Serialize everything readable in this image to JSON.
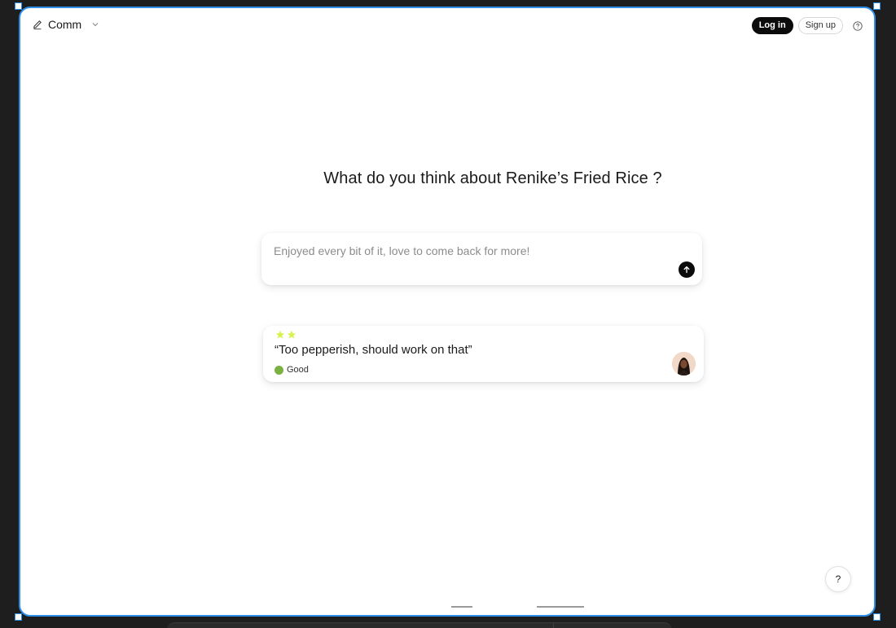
{
  "header": {
    "brand_name": "Comm",
    "brand_icon": "pen-icon",
    "login_label": "Log in",
    "signup_label": "Sign up",
    "help_icon": "help-circle-icon"
  },
  "main": {
    "question": "What do you think about Renike’s Fried Rice ?",
    "feedback_input": {
      "value": "",
      "placeholder": "Enjoyed every bit of it, love to come back for more!"
    },
    "send_icon": "arrow-up-icon"
  },
  "review": {
    "rating": 2,
    "star_color": "#d9f24a",
    "quote": "“Too pepperish, should work on that”",
    "badge_label": "Good",
    "badge_color": "#7bb142"
  },
  "help_button_label": "?",
  "colors": {
    "accent": "#0b0b0b",
    "frame_border": "#2f8fe8"
  }
}
